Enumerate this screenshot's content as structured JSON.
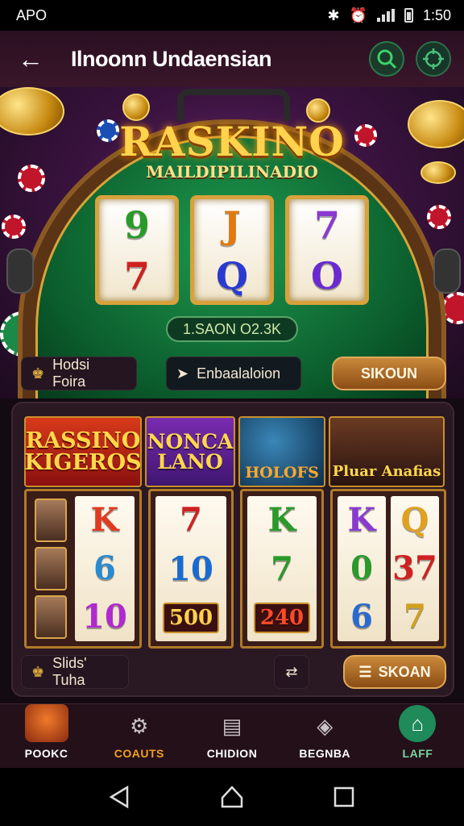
{
  "status_bar": {
    "carrier": "APO",
    "time": "1:50"
  },
  "header": {
    "title": "Ilnoonn Undaensian"
  },
  "hero": {
    "logo_main": "RASKINO",
    "logo_sub": "MAILDIPILINADIO",
    "reels": [
      {
        "top": "9",
        "bottom": "7",
        "top_color": "#2a9a2a",
        "bottom_color": "#d02020"
      },
      {
        "top": "J",
        "bottom": "Q",
        "top_color": "#e07a10",
        "bottom_color": "#2a3ad0"
      },
      {
        "top": "7",
        "bottom": "O",
        "top_color": "#8a3ad0",
        "bottom_color": "#6a2ad0"
      }
    ],
    "win_display": "1.SAON O2.3K"
  },
  "hero_controls": {
    "left_label": "Hodsi Foira",
    "middle_label": "Enbaalaloion",
    "right_label": "SIKOUN"
  },
  "banners": [
    {
      "text": "RASSINO KIGEROS"
    },
    {
      "text": "NONCA LANO"
    },
    {
      "text": "HOLOFS"
    },
    {
      "text": "Pluar Anafias"
    }
  ],
  "machines": [
    {
      "symbols": [
        "K",
        "6",
        "10"
      ],
      "colors": [
        "#e03a20",
        "#2a8ad0",
        "#b02ad0"
      ]
    },
    {
      "symbols": [
        "7",
        "10",
        "500"
      ],
      "colors": [
        "#d02020",
        "#1a6ad0",
        "#ffd24a"
      ]
    },
    {
      "symbols": [
        "K",
        "7",
        "240"
      ],
      "colors": [
        "#2a9a2a",
        "#2a9a2a",
        "#ff4a2a"
      ]
    },
    {
      "symbols": [
        "K",
        "Q",
        "0",
        "37",
        "6",
        "7"
      ],
      "colors": [
        "#8a3ad0",
        "#e0a020",
        "#2a9a2a",
        "#d02020",
        "#2a6ad0",
        "#d0a020"
      ]
    }
  ],
  "panel_controls": {
    "left_label": "Slids' Tuha",
    "right_label": "SKOAN"
  },
  "bottom_nav": [
    {
      "label": "POOKC",
      "icon": "fox-avatar-icon"
    },
    {
      "label": "COAUTS",
      "icon": "gear-badge-icon"
    },
    {
      "label": "CHIDION",
      "icon": "chat-document-icon"
    },
    {
      "label": "BEGNBA",
      "icon": "shield-icon"
    },
    {
      "label": "LAFF",
      "icon": "home-icon"
    }
  ]
}
